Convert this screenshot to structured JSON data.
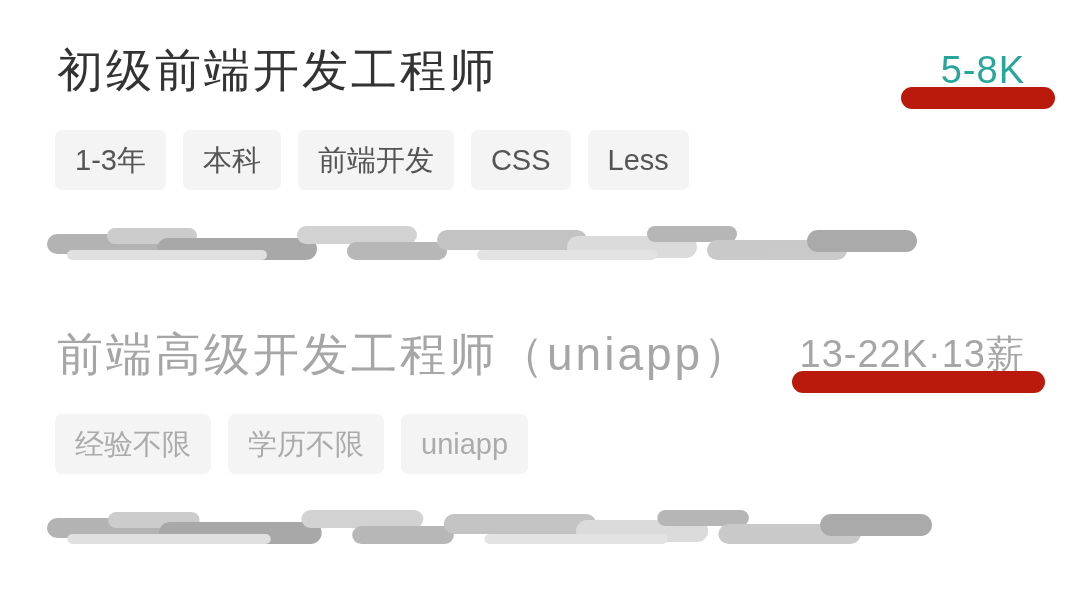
{
  "jobs": [
    {
      "title": "初级前端开发工程师",
      "salary": "5-8K",
      "inactive": false,
      "tags": [
        "1-3年",
        "本科",
        "前端开发",
        "CSS",
        "Less"
      ]
    },
    {
      "title": "前端高级开发工程师（uniapp）",
      "salary": "13-22K·13薪",
      "inactive": true,
      "tags": [
        "经验不限",
        "学历不限",
        "uniapp"
      ]
    }
  ]
}
